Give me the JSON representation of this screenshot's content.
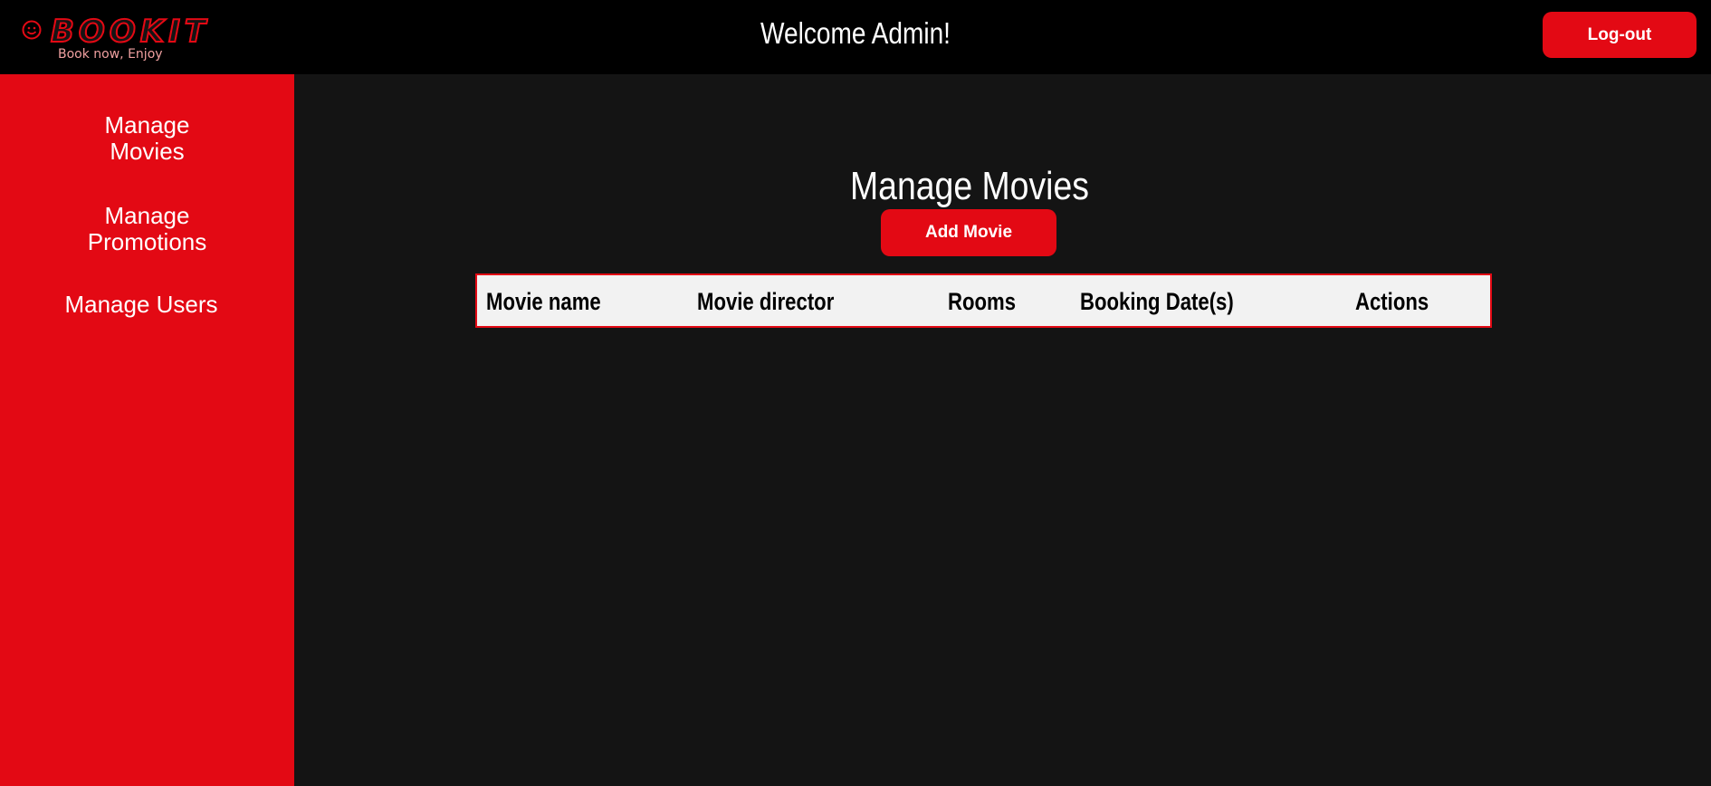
{
  "header": {
    "logo_text": "BOOKIT",
    "logo_tagline": "Book now, Enjoy",
    "welcome": "Welcome Admin!",
    "logout_label": "Log-out"
  },
  "sidebar": {
    "items": [
      {
        "label_lines": [
          "Manage",
          "Movies"
        ]
      },
      {
        "label_lines": [
          "Manage",
          "Promotions"
        ]
      },
      {
        "label_lines": [
          "Manage Users"
        ]
      }
    ]
  },
  "main": {
    "title": "Manage Movies",
    "add_button_label": "Add Movie",
    "table": {
      "columns": [
        "Movie name",
        "Movie director",
        "Rooms",
        "Booking Date(s)",
        "Actions"
      ],
      "rows": []
    }
  },
  "colors": {
    "accent": "#e30914",
    "topbar": "#000000",
    "background": "#141414",
    "table_header": "#f2f2f2"
  }
}
